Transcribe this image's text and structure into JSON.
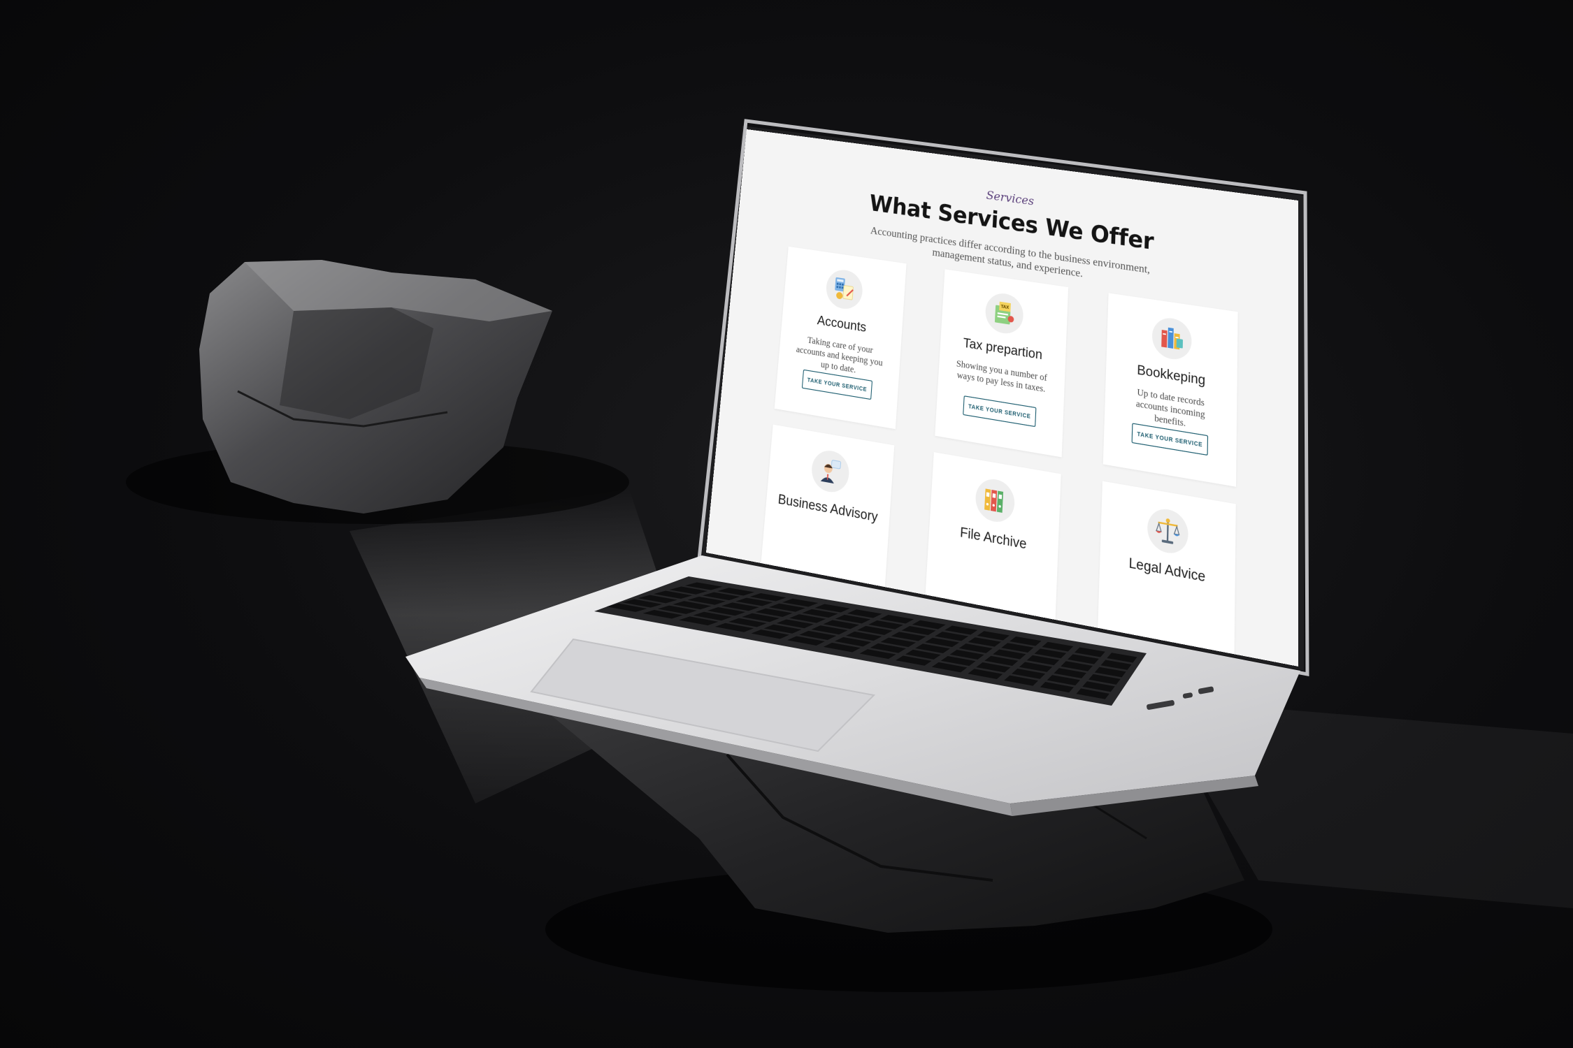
{
  "page": {
    "eyebrow": "Services",
    "title": "What Services We Offer",
    "subtitle": "Accounting practices differ according to the business environment, management status, and experience."
  },
  "services": [
    {
      "title": "Accounts",
      "text": "Taking care of your accounts and keeping you up to date.",
      "cta": "TAKE YOUR SERVICE",
      "icon": "calculator-documents-icon"
    },
    {
      "title": "Tax prepartion",
      "text": "Showing you a number of ways to pay less in taxes.",
      "cta": "TAKE YOUR SERVICE",
      "icon": "tax-document-icon"
    },
    {
      "title": "Bookkeping",
      "text": "Up to date records accounts incoming benefits.",
      "cta": "TAKE YOUR SERVICE",
      "icon": "ledger-books-icon"
    },
    {
      "title": "Business Advisory",
      "icon": "advisor-person-icon"
    },
    {
      "title": "File Archive",
      "icon": "archive-binders-icon"
    },
    {
      "title": "Legal Advice",
      "icon": "scales-of-justice-icon"
    }
  ],
  "colors": {
    "background": "#0d0d0f",
    "screen_background": "#f4f4f4",
    "card_background": "#ffffff",
    "eyebrow": "#5a3f7a",
    "cta_border": "#1e5e70",
    "laptop_body": "#d9d9db"
  }
}
